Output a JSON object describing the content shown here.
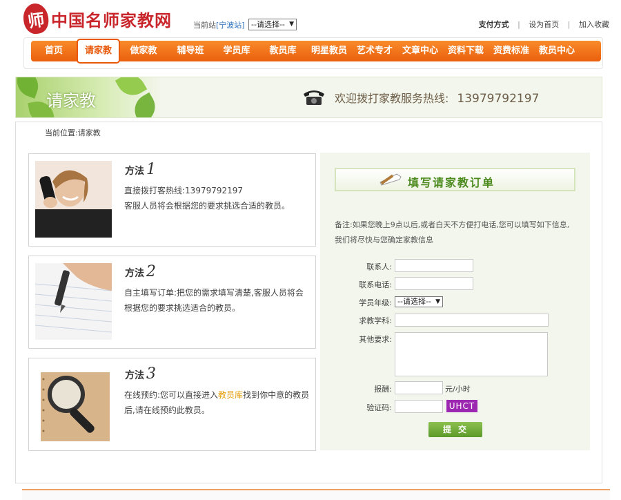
{
  "header": {
    "logo_mark": "师",
    "logo_text": "中国名师家教网",
    "station_label": "当前站",
    "station_link": "[宁波站]",
    "station_select": "--请选择--",
    "links": [
      "支付方式",
      "设为首页",
      "加入收藏"
    ]
  },
  "nav": {
    "items": [
      "首页",
      "请家教",
      "做家教",
      "辅导班",
      "学员库",
      "教员库",
      "明星教员",
      "艺术专才",
      "文章中心",
      "资料下载",
      "资费标准",
      "教员中心"
    ],
    "active_index": 1
  },
  "banner": {
    "title": "请家教",
    "hotline_label": "欢迎拨打家教服务热线:",
    "hotline_number": "13979792197"
  },
  "breadcrumb": "当前位置:请家教",
  "methods": [
    {
      "title": "方法",
      "num": "1",
      "line1": "直接拨打客热线:13979792197",
      "line2": "客服人员将会根据您的要求挑选合适的教员。"
    },
    {
      "title": "方法",
      "num": "2",
      "line1": "自主填写订单:把您的需求填写清楚,客服人员将会根据您的要求挑选适合的教员。"
    },
    {
      "title": "方法",
      "num": "3",
      "pre": "在线预约:您可以直接进入",
      "link": "教员库",
      "post": "找到你中意的教员后,请在线预约此教员。"
    }
  ],
  "form": {
    "banner_title": "填写请家教订单",
    "note": "备注:如果您晚上9点以后,或者白天不方便打电话,您可以填写如下信息,我们将尽快与您确定家教信息",
    "labels": {
      "contact": "联系人:",
      "phone": "联系电话:",
      "grade": "学员年级:",
      "subject": "求教学科:",
      "other": "其他要求:",
      "pay": "报酬:",
      "captcha": "验证码:"
    },
    "grade_select": "--请选择--",
    "pay_unit": "元/小时",
    "captcha_text": "UHCT",
    "submit_label": "提交"
  }
}
